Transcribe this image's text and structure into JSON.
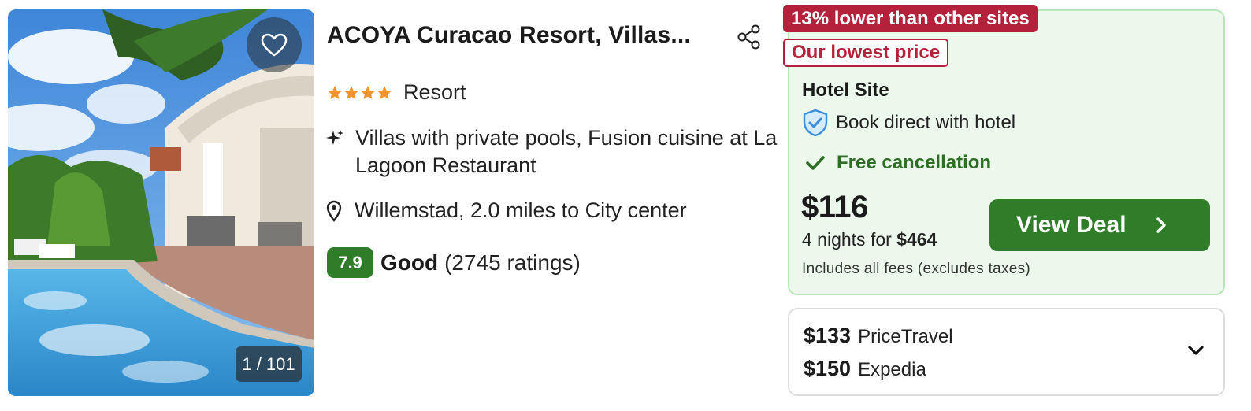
{
  "photo": {
    "counter": "1 / 101"
  },
  "hotel": {
    "name": "ACOYA Curacao Resort, Villas...",
    "stars": 4,
    "type": "Resort",
    "highlight": "Villas with private pools, Fusion cuisine at La Lagoon Restaurant",
    "location": "Willemstad, 2.0 miles to City center",
    "rating_score": "7.9",
    "rating_word": "Good",
    "rating_count": "(2745 ratings)"
  },
  "deal": {
    "badge_lower": "13% lower than other sites",
    "badge_lowest": "Our lowest price",
    "site": "Hotel Site",
    "book_direct": "Book direct with hotel",
    "cancellation": "Free cancellation",
    "price": "$116",
    "nights_text": "4 nights for",
    "total": "$464",
    "fees_note": "Includes all fees (excludes taxes)",
    "cta": "View Deal"
  },
  "other_offers": [
    {
      "price": "$133",
      "site": "PriceTravel"
    },
    {
      "price": "$150",
      "site": "Expedia"
    }
  ],
  "colors": {
    "green": "#2f7d28",
    "red": "#b3223a",
    "card_bg": "#ebf8eb",
    "star": "#f0932b"
  },
  "icons": [
    "heart-icon",
    "share-icon",
    "star-icon",
    "sparkle-icon",
    "location-pin-icon",
    "shield-check-icon",
    "checkmark-icon",
    "chevron-right-icon",
    "chevron-down-icon"
  ]
}
